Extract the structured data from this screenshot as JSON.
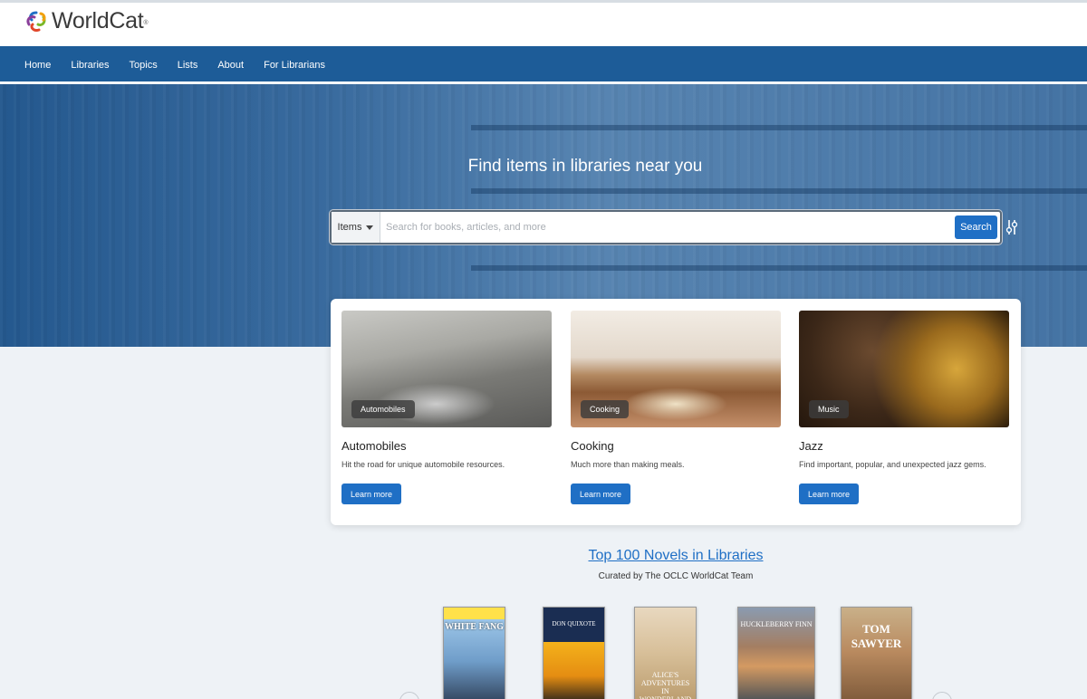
{
  "header": {
    "logo_text": "WorldCat",
    "logo_mark": "®"
  },
  "nav": {
    "items": [
      {
        "label": "Home"
      },
      {
        "label": "Libraries"
      },
      {
        "label": "Topics"
      },
      {
        "label": "Lists"
      },
      {
        "label": "About"
      },
      {
        "label": "For Librarians"
      }
    ]
  },
  "hero": {
    "title": "Find items in libraries near you"
  },
  "search": {
    "type_label": "Items",
    "placeholder": "Search for books, articles, and more",
    "button_label": "Search"
  },
  "topics": [
    {
      "badge": "Automobiles",
      "title": "Automobiles",
      "desc": "Hit the road for unique automobile resources.",
      "button": "Learn more"
    },
    {
      "badge": "Cooking",
      "title": "Cooking",
      "desc": "Much more than making meals.",
      "button": "Learn more"
    },
    {
      "badge": "Music",
      "title": "Jazz",
      "desc": "Find important, popular, and unexpected jazz gems.",
      "button": "Learn more"
    }
  ],
  "novels": {
    "title": "Top 100 Novels in Libraries",
    "subtitle": "Curated by The OCLC WorldCat Team",
    "books": [
      {
        "cover_text": "WHITE FANG"
      },
      {
        "cover_text": "DON QUIXOTE"
      },
      {
        "cover_text": "ALICE'S ADVENTURES IN WONDERLAND"
      },
      {
        "cover_text": "HUCKLEBERRY FINN"
      },
      {
        "cover_text": "TOM SAWYER"
      }
    ]
  },
  "colors": {
    "nav_bg": "#1d5c98",
    "accent": "#1f6fc5",
    "page_bg": "#eef2f6"
  }
}
